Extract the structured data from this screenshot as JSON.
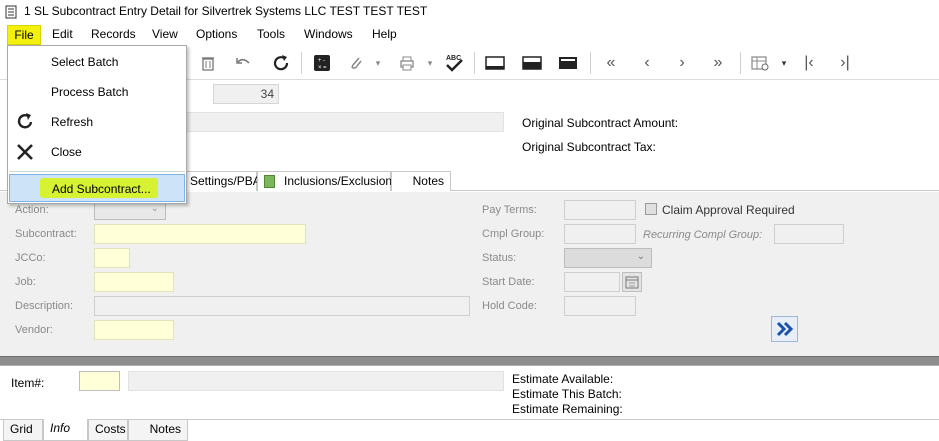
{
  "window": {
    "title": "1 SL Subcontract Entry Detail for Silvertrek Systems LLC TEST TEST TEST"
  },
  "menubar": [
    "File",
    "Edit",
    "Records",
    "View",
    "Options",
    "Tools",
    "Windows",
    "Help"
  ],
  "file_menu": {
    "items": [
      "Select Batch",
      "Process Batch",
      "Refresh",
      "Close"
    ],
    "highlighted": "Add Subcontract..."
  },
  "header": {
    "batch_value": "34",
    "original_amount_label": "Original Subcontract Amount:",
    "original_tax_label": "Original Subcontract Tax:"
  },
  "tabs_top": [
    "Settings/PBA",
    "Inclusions/Exclusions",
    "Notes"
  ],
  "form": {
    "action": "Action:",
    "subcontract": "Subcontract:",
    "jcco": "JCCo:",
    "job": "Job:",
    "description": "Description:",
    "vendor": "Vendor:",
    "pay_terms": "Pay Terms:",
    "cmpl_group": "Cmpl Group:",
    "status": "Status:",
    "start_date": "Start Date:",
    "hold_code": "Hold Code:",
    "claim_approval": "Claim Approval Required",
    "recurring_compl_group": "Recurring Compl Group:"
  },
  "bottom": {
    "item_label": "Item#:",
    "estimate_available": "Estimate Available:",
    "estimate_this_batch": "Estimate This Batch:",
    "estimate_remaining": "Estimate Remaining:"
  },
  "tabs_bottom": [
    "Grid",
    "Info",
    "Costs",
    "Notes"
  ],
  "colors": {
    "highlight_yellow": "#f3f00d",
    "selection_blue": "#cde3f7",
    "field_yellow": "#ffffd8"
  }
}
